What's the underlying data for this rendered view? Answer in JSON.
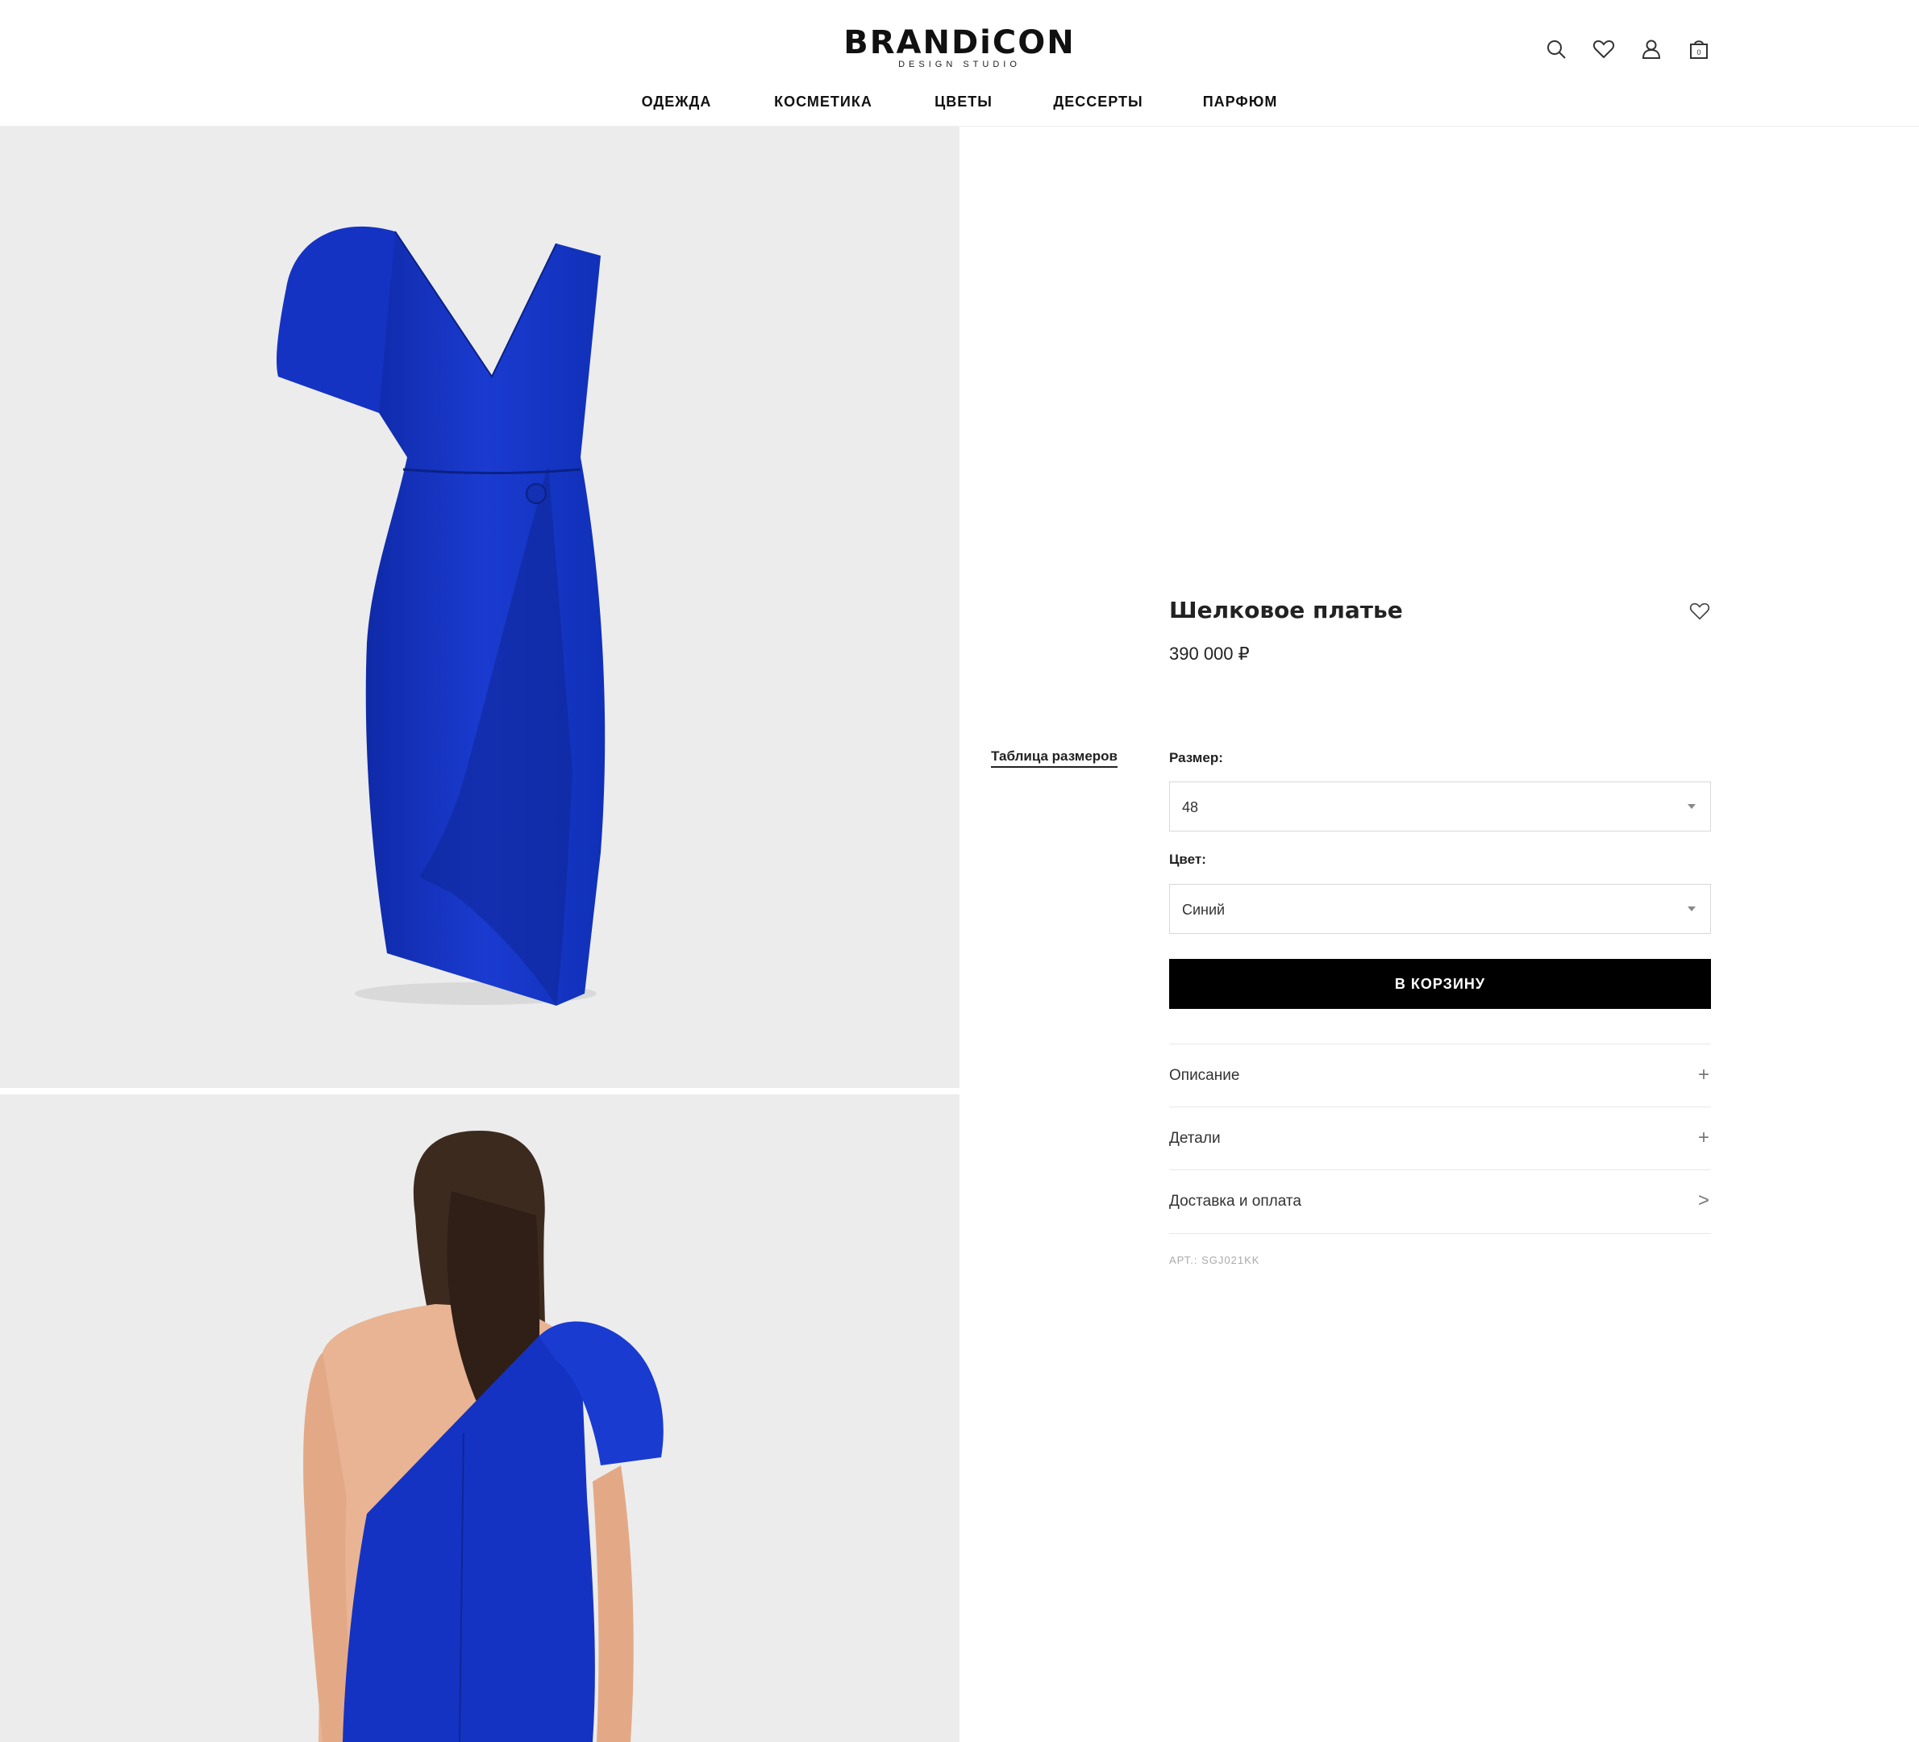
{
  "header": {
    "logo": "BRANDiCON",
    "logo_sub": "DESIGN STUDIO",
    "nav": [
      "ОДЕЖДА",
      "КОСМЕТИКА",
      "ЦВЕТЫ",
      "ДЕССЕРТЫ",
      "ПАРФЮМ"
    ],
    "icons": [
      "search-icon",
      "heart-icon",
      "user-icon",
      "cart-icon"
    ],
    "cart_count": "0"
  },
  "gallery": {
    "images": [
      "dress-front-photo",
      "model-back-photo"
    ],
    "dress_color": "#1533c2"
  },
  "product": {
    "title": "Шелковое платье",
    "price": "390 000 ₽",
    "size_label": "Размер:",
    "size_table_link": "Таблица размеров",
    "size_value": "48",
    "color_label": "Цвет:",
    "color_value": "Синий",
    "add_to_cart": "В КОРЗИНУ",
    "accordion": [
      {
        "label": "Описание",
        "sign": "+"
      },
      {
        "label": "Детали",
        "sign": "+"
      },
      {
        "label": "Доставка и оплата",
        "sign": ">"
      }
    ],
    "sku": "АРТ.: SGJ021KK"
  }
}
